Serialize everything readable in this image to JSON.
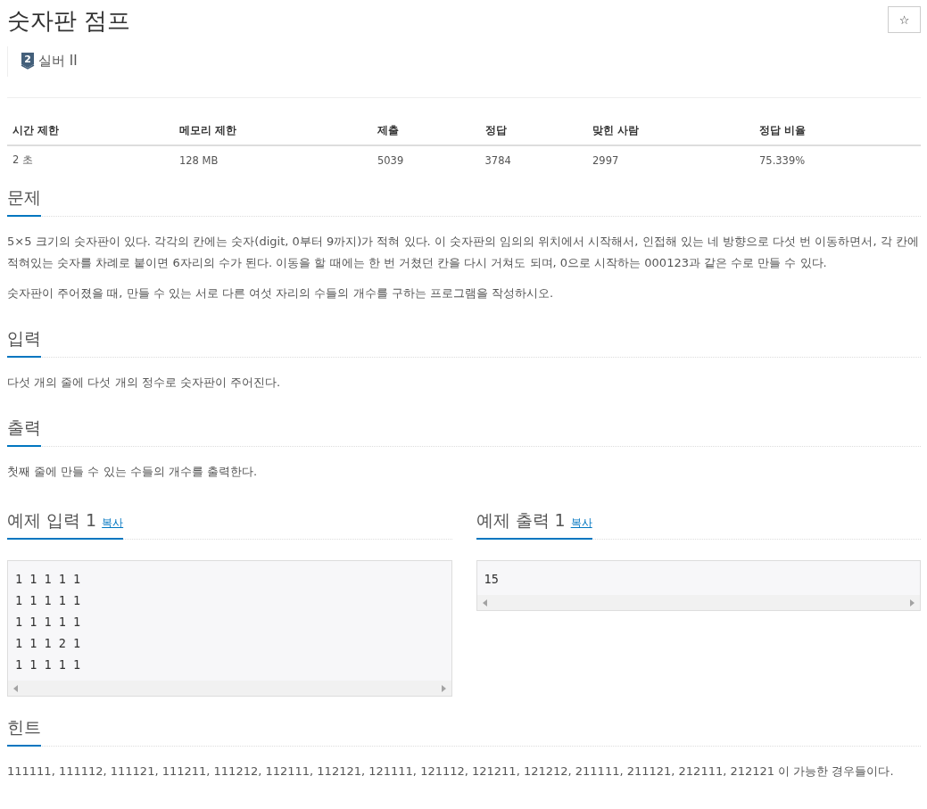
{
  "title": "숫자판 점프",
  "star_button": "☆",
  "tier": {
    "badge": "2",
    "label": "실버 II"
  },
  "info_table": {
    "columns": [
      "시간 제한",
      "메모리 제한",
      "제출",
      "정답",
      "맞힌 사람",
      "정답 비율"
    ],
    "rows": [
      [
        "2 초",
        "128 MB",
        "5039",
        "3784",
        "2997",
        "75.339%"
      ]
    ]
  },
  "sections": [
    {
      "heading": "문제",
      "paragraphs": [
        "5×5 크기의 숫자판이 있다. 각각의 칸에는 숫자(digit, 0부터 9까지)가 적혀 있다. 이 숫자판의 임의의 위치에서 시작해서, 인접해 있는 네 방향으로 다섯 번 이동하면서, 각 칸에 적혀있는 숫자를 차례로 붙이면 6자리의 수가 된다. 이동을 할 때에는 한 번 거쳤던 칸을 다시 거쳐도 되며, 0으로 시작하는 000123과 같은 수로 만들 수 있다.",
        "숫자판이 주어졌을 때, 만들 수 있는 서로 다른 여섯 자리의 수들의 개수를 구하는 프로그램을 작성하시오."
      ]
    },
    {
      "heading": "입력",
      "paragraphs": [
        "다섯 개의 줄에 다섯 개의 정수로 숫자판이 주어진다."
      ]
    },
    {
      "heading": "출력",
      "paragraphs": [
        "첫째 줄에 만들 수 있는 수들의 개수를 출력한다."
      ]
    }
  ],
  "samples": [
    {
      "heading": "예제 입력 1",
      "copy": "복사",
      "lines": [
        "1 1 1 1 1",
        "1 1 1 1 1",
        "1 1 1 1 1",
        "1 1 1 2 1",
        "1 1 1 1 1"
      ]
    },
    {
      "heading": "예제 출력 1",
      "copy": "복사",
      "lines": [
        "15"
      ]
    }
  ],
  "hint": {
    "heading": "힌트",
    "paragraphs": [
      "111111, 111112, 111121, 111211, 111212, 112111, 112121, 121111, 121112, 121211, 121212, 211111, 211121, 212111, 212121 이 가능한 경우들이다."
    ]
  }
}
